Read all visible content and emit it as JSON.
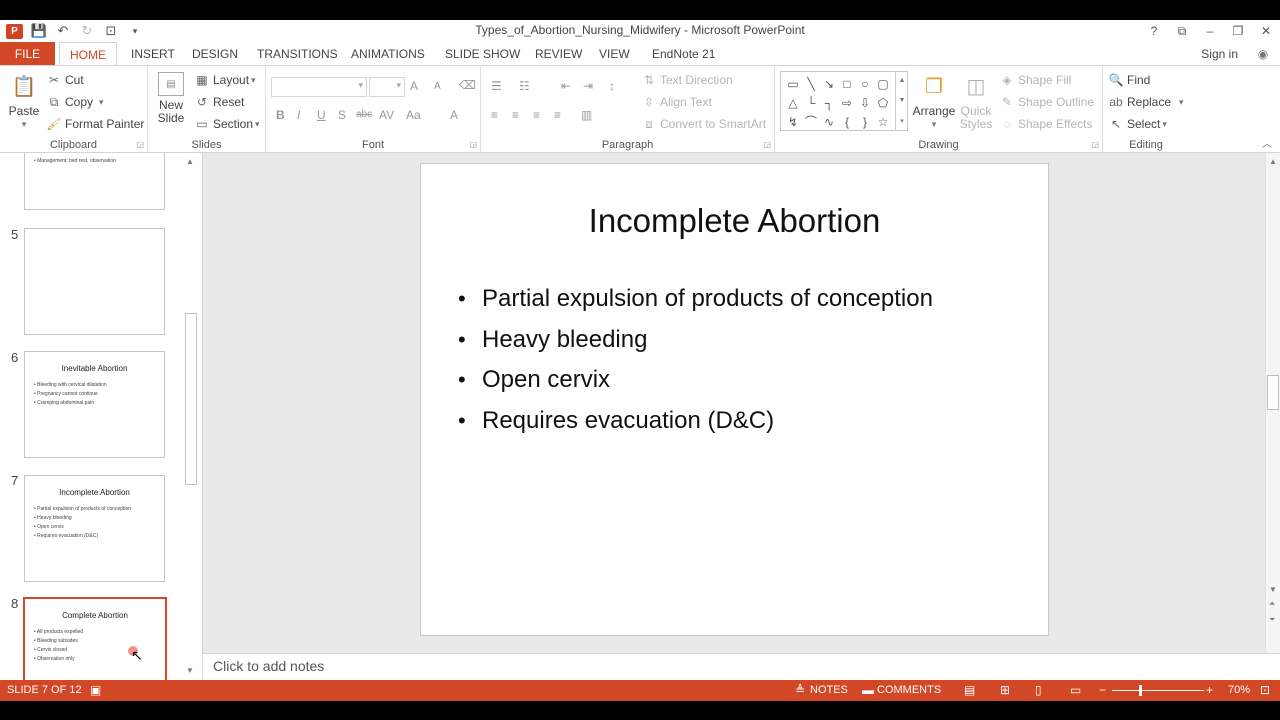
{
  "window": {
    "title": "Types_of_Abortion_Nursing_Midwifery - Microsoft PowerPoint",
    "controls": [
      "?",
      "⧉",
      "–",
      "❐",
      "✕"
    ]
  },
  "tabs": {
    "file": "FILE",
    "home": "HOME",
    "insert": "INSERT",
    "design": "DESIGN",
    "transitions": "TRANSITIONS",
    "animations": "ANIMATIONS",
    "slideshow": "SLIDE SHOW",
    "review": "REVIEW",
    "view": "VIEW",
    "endnote": "EndNote 21",
    "signin": "Sign in"
  },
  "ribbon": {
    "clipboard": {
      "label": "Clipboard",
      "paste": "Paste",
      "cut": "Cut",
      "copy": "Copy",
      "format_painter": "Format Painter"
    },
    "slides": {
      "label": "Slides",
      "new_slide_line1": "New",
      "new_slide_line2": "Slide",
      "layout": "Layout",
      "reset": "Reset",
      "section": "Section"
    },
    "font": {
      "label": "Font",
      "bold": "B",
      "italic": "I",
      "underline": "U",
      "shadow": "S",
      "strike": "abc",
      "spacing": "AV",
      "case": "Aa",
      "color": "A",
      "grow": "A",
      "shrink": "A"
    },
    "paragraph": {
      "label": "Paragraph",
      "text_direction": "Text Direction",
      "align_text": "Align Text",
      "convert_smartart": "Convert to SmartArt"
    },
    "drawing": {
      "label": "Drawing",
      "arrange": "Arrange",
      "quick_styles_line1": "Quick",
      "quick_styles_line2": "Styles",
      "shape_fill": "Shape Fill",
      "shape_outline": "Shape Outline",
      "shape_effects": "Shape Effects"
    },
    "editing": {
      "label": "Editing",
      "find": "Find",
      "replace": "Replace",
      "select": "Select"
    }
  },
  "thumbnails": {
    "t4": {
      "partial_text": "Management: bed rest, observation"
    },
    "t5": {
      "number": "5"
    },
    "t6": {
      "number": "6",
      "title": "Inevitable Abortion",
      "bullets": [
        "Bleeding with cervical dilatation",
        "Pregnancy cannot continue",
        "Cramping abdominal pain"
      ]
    },
    "t7": {
      "number": "7",
      "title": "Incomplete Abortion",
      "bullets": [
        "Partial expulsion of products of conception",
        "Heavy bleeding",
        "Open cervix",
        "Requires evacuation (D&C)"
      ]
    },
    "t8": {
      "number": "8",
      "title": "Complete Abortion",
      "bullets": [
        "All products expelled",
        "Bleeding subsides",
        "Cervix closed",
        "Observation only"
      ]
    }
  },
  "slide": {
    "title": "Incomplete Abortion",
    "bullets": [
      "Partial expulsion of products of conception",
      "Heavy bleeding",
      "Open cervix",
      "Requires evacuation (D&C)"
    ]
  },
  "notes": {
    "placeholder": "Click to add notes"
  },
  "status": {
    "slide_indicator": "SLIDE 7 OF 12",
    "notes": "NOTES",
    "comments": "COMMENTS",
    "zoom": "70%"
  },
  "colors": {
    "accent": "#d24726",
    "canvas": "#e9e9e9"
  }
}
